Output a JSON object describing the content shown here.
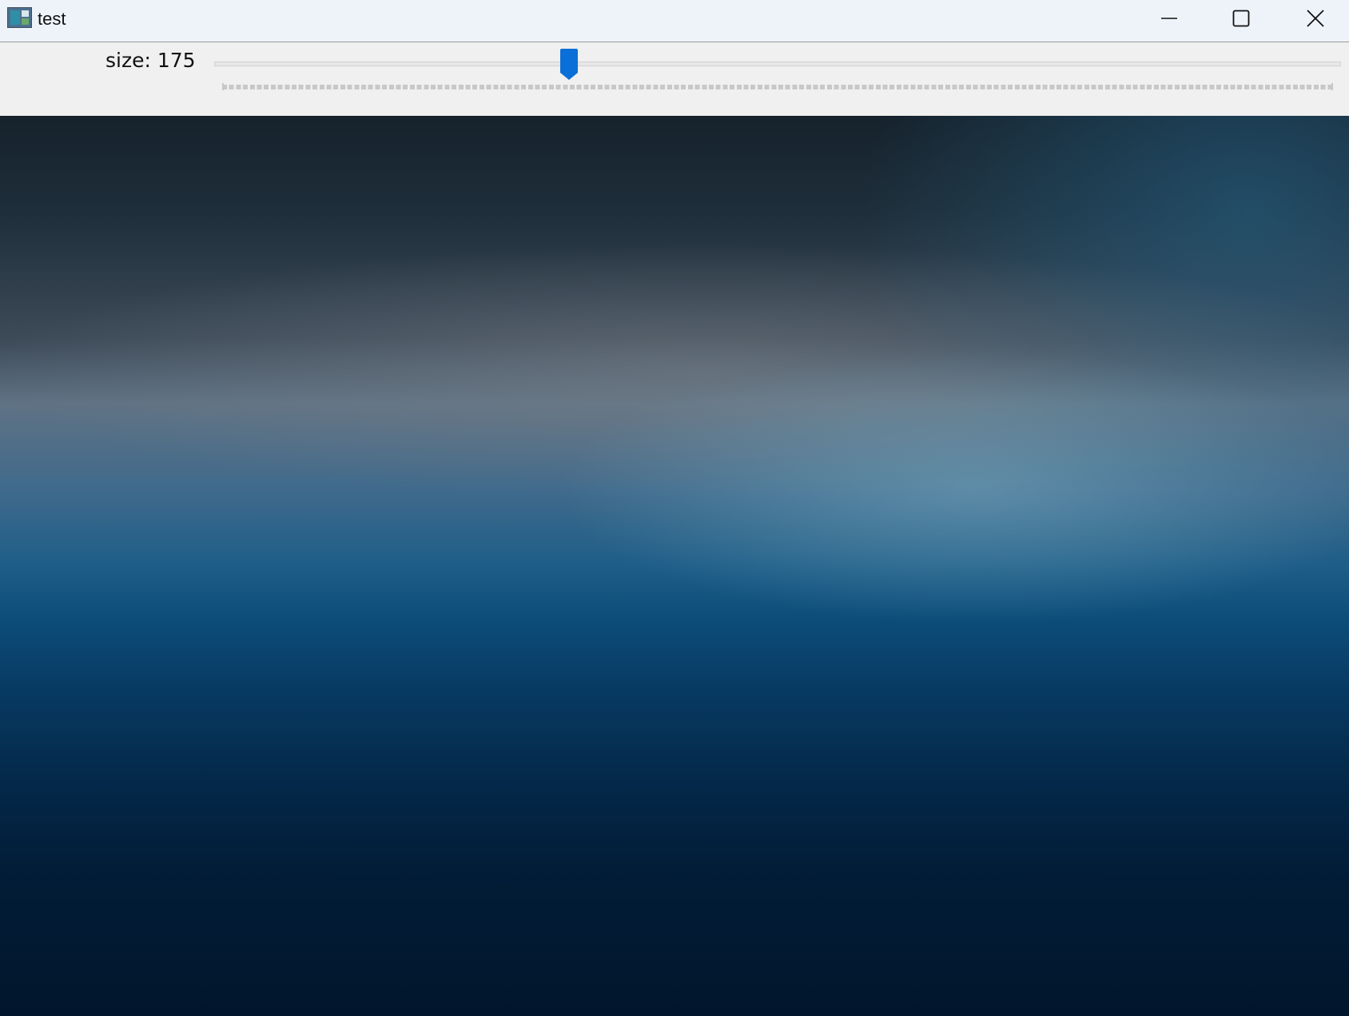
{
  "window": {
    "title": "test",
    "icon": "app-window-icon",
    "controls": {
      "minimize_icon": "minimize-icon",
      "maximize_icon": "maximize-icon",
      "close_icon": "close-icon"
    }
  },
  "toolbar": {
    "size_label": "size: 175",
    "slider": {
      "value": 175,
      "level_fraction": 0.312,
      "accent_color": "#0a6fd6"
    }
  },
  "canvas": {
    "image": "blurred-blue-gradient-background"
  }
}
